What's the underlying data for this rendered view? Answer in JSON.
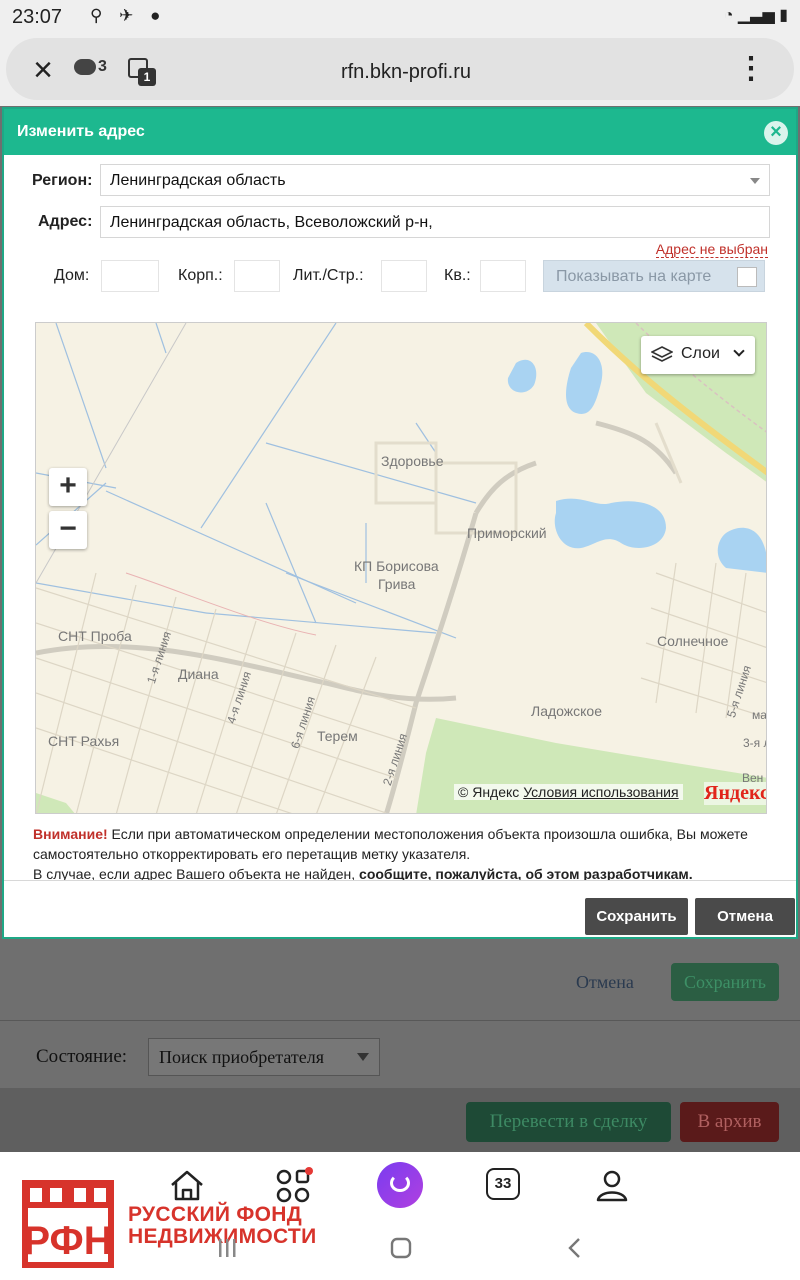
{
  "status_bar": {
    "time": "23:07"
  },
  "browser": {
    "url": "rfn.bkn-profi.ru",
    "chat_count": "3",
    "tabs_count": "1"
  },
  "background_page": {
    "cancel_label": "Отмена",
    "save_label": "Сохранить",
    "state_label": "Состояние:",
    "state_value": "Поиск приобретателя",
    "deal_button": "Перевести в сделку",
    "archive_button": "В архив"
  },
  "dialog": {
    "title": "Изменить адрес",
    "region_label": "Регион:",
    "region_value": "Ленинградская область",
    "address_label": "Адрес:",
    "address_value": "Ленинградская область, Всеволожский р-н,",
    "address_warning": "Адрес не выбран",
    "house_label": "Дом:",
    "building_label": "Корп.:",
    "letter_label": "Лит./Стр.:",
    "apartment_label": "Кв.:",
    "show_on_map_label": "Показывать на карте",
    "show_on_map_checked": false,
    "map": {
      "zoom_in": "+",
      "zoom_out": "−",
      "layers_label": "Слои",
      "labels": {
        "zdorovie": "Здоровье",
        "primorsky": "Приморский",
        "kp_borisova_1": "КП Борисова",
        "kp_borisova_2": "Грива",
        "snt_proba": "СНТ Проба",
        "diana": "Диана",
        "solnechnoe": "Солнечное",
        "ladozhskoe": "Ладожское",
        "snt_rakhya": "СНТ Рахья",
        "terem": "Терем",
        "line_1": "1-я линия",
        "line_4": "4-я линия",
        "line_6": "6-я линия",
        "line_2": "2-я линия",
        "line_5": "5-я линия",
        "line_3": "3-я л",
        "ven": "Вен",
        "ma": "ма"
      },
      "copyright": "© Яндекс",
      "terms_link": "Условия использования",
      "brand": "Яндекс"
    },
    "notice_warn": "Внимание!",
    "notice_text": " Если при автоматическом определении местоположения объекта произошла ошибка, Вы можете самостоятельно откорректировать его перетащив метку указателя.",
    "notice_text2": "В случае, если адрес Вашего объекта не найден, ",
    "notice_link": "сообщите, пожалуйста, об этом разработчикам.",
    "save_button": "Сохранить",
    "cancel_button": "Отмена"
  },
  "bottom_nav": {
    "tabs_badge": "33",
    "logo_line1": "РУССКИЙ  ФОНД",
    "logo_line2": "НЕДВИЖИМОСТИ"
  },
  "colors": {
    "header_green": "#1db88f",
    "warning_red": "#c0302a",
    "button_dark": "#4a4a4a",
    "brand_red": "#d7332b"
  }
}
